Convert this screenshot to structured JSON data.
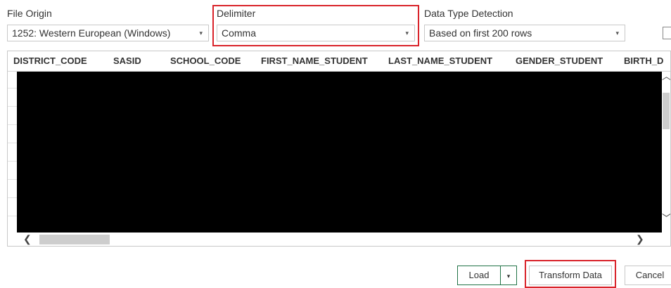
{
  "file_origin": {
    "label": "File Origin",
    "value": "1252: Western European (Windows)"
  },
  "delimiter": {
    "label": "Delimiter",
    "value": "Comma"
  },
  "data_type_detection": {
    "label": "Data Type Detection",
    "value": "Based on first 200 rows"
  },
  "table": {
    "columns": [
      "DISTRICT_CODE",
      "SASID",
      "SCHOOL_CODE",
      "FIRST_NAME_STUDENT",
      "LAST_NAME_STUDENT",
      "GENDER_STUDENT",
      "BIRTH_D"
    ]
  },
  "icons": {
    "chevron": "▾",
    "left": "❮",
    "right": "❯",
    "up": "︿",
    "down": "﹀"
  },
  "buttons": {
    "load": "Load",
    "transform": "Transform Data",
    "cancel": "Cancel"
  },
  "colors": {
    "highlight": "#d9232a",
    "load_border": "#217346"
  }
}
